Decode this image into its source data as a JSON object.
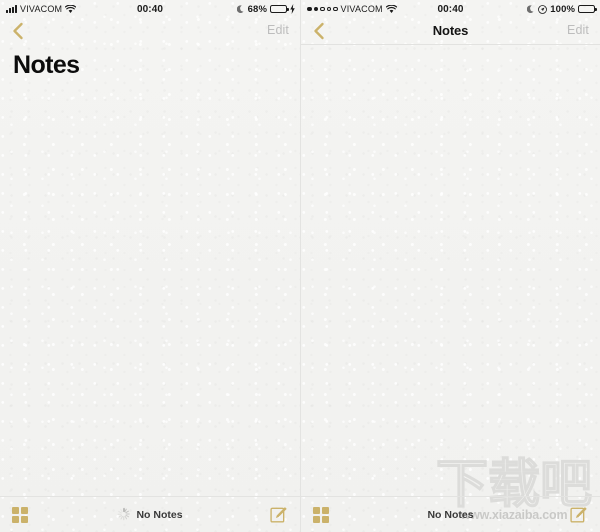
{
  "panels": [
    {
      "id": "left",
      "statusbar": {
        "signal_style": "bars",
        "signal_strength": 4,
        "carrier": "VIVACOM",
        "wifi_icon": "wifi-icon",
        "time": "00:40",
        "dnd_icon": "moon-icon",
        "battery_percent": "68%",
        "battery_level": 68,
        "battery_color": "#53d769",
        "charging": true,
        "charging_icon": "lightning-bolt-icon"
      },
      "navbar": {
        "back_icon": "chevron-left-icon",
        "title": "Notes",
        "title_style": "large",
        "edit_label": "Edit"
      },
      "toolbar": {
        "grid_icon": "grid-icon",
        "spinner_icon": "activity-spinner-icon",
        "status_text": "No Notes",
        "compose_icon": "compose-icon"
      },
      "watermark": null
    },
    {
      "id": "right",
      "statusbar": {
        "signal_style": "dots",
        "signal_strength": 2,
        "signal_dots_total": 5,
        "carrier": "VIVACOM",
        "wifi_icon": "wifi-icon",
        "time": "00:40",
        "dnd_icon": "moon-icon",
        "location_icon": "location-icon",
        "battery_percent": "100%",
        "battery_level": 100,
        "battery_color": "#1b1b1b",
        "charging": false
      },
      "navbar": {
        "back_icon": "chevron-left-icon",
        "title": "Notes",
        "title_style": "compact",
        "edit_label": "Edit"
      },
      "toolbar": {
        "grid_icon": "grid-icon",
        "status_text": "No Notes",
        "compose_icon": "compose-icon"
      },
      "watermark": {
        "logo_text": "下载吧",
        "url_text": "www.xiazaiba.com"
      }
    }
  ],
  "colors": {
    "gold": "#cbb26a",
    "background": "#f3f3f1",
    "divider": "#e3e3e1",
    "edit_gray": "#bdbdbd",
    "watermark_gray": "#c9c9c7"
  }
}
